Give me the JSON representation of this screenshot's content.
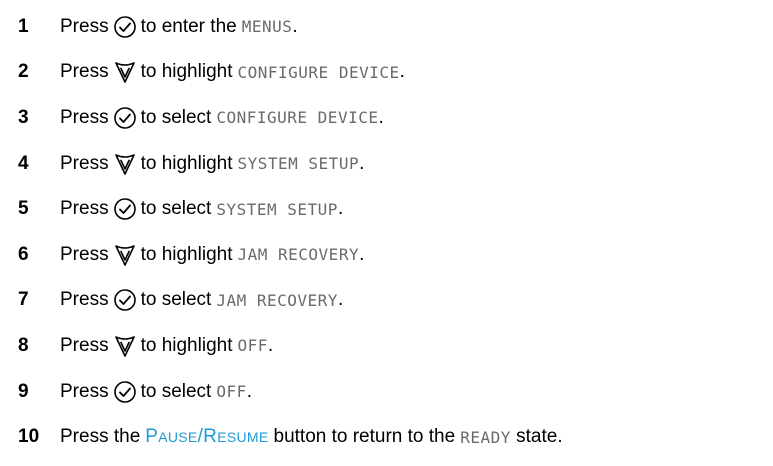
{
  "steps": [
    {
      "num": "1",
      "verb": "Press",
      "icon": "select-checkmark-icon",
      "pre": "to enter the",
      "term": "MENUS",
      "post": "."
    },
    {
      "num": "2",
      "verb": "Press",
      "icon": "down-arrow-icon",
      "pre": "to highlight",
      "term": "CONFIGURE DEVICE",
      "post": "."
    },
    {
      "num": "3",
      "verb": "Press",
      "icon": "select-checkmark-icon",
      "pre": "to select",
      "term": "CONFIGURE DEVICE",
      "post": "."
    },
    {
      "num": "4",
      "verb": "Press",
      "icon": "down-arrow-icon",
      "pre": "to highlight",
      "term": "SYSTEM SETUP",
      "post": "."
    },
    {
      "num": "5",
      "verb": "Press",
      "icon": "select-checkmark-icon",
      "pre": "to select",
      "term": "SYSTEM SETUP",
      "post": "."
    },
    {
      "num": "6",
      "verb": "Press",
      "icon": "down-arrow-icon",
      "pre": "to highlight",
      "term": "JAM RECOVERY",
      "post": "."
    },
    {
      "num": "7",
      "verb": "Press",
      "icon": "select-checkmark-icon",
      "pre": "to select",
      "term": "JAM RECOVERY",
      "post": "."
    },
    {
      "num": "8",
      "verb": "Press",
      "icon": "down-arrow-icon",
      "pre": "to highlight",
      "term": "OFF",
      "post": "."
    },
    {
      "num": "9",
      "verb": "Press",
      "icon": "select-checkmark-icon",
      "pre": "to select",
      "term": "OFF",
      "post": "."
    }
  ],
  "final_step": {
    "num": "10",
    "pre": "Press the",
    "button_cap1": "P",
    "button_rest1": "ause",
    "button_sep": "/",
    "button_cap2": "R",
    "button_rest2": "esume",
    "mid": "button to return to the",
    "term": "READY",
    "post": "state."
  },
  "colors": {
    "brand": "#1e9bd7",
    "lcd_text": "#6a6a6a"
  }
}
